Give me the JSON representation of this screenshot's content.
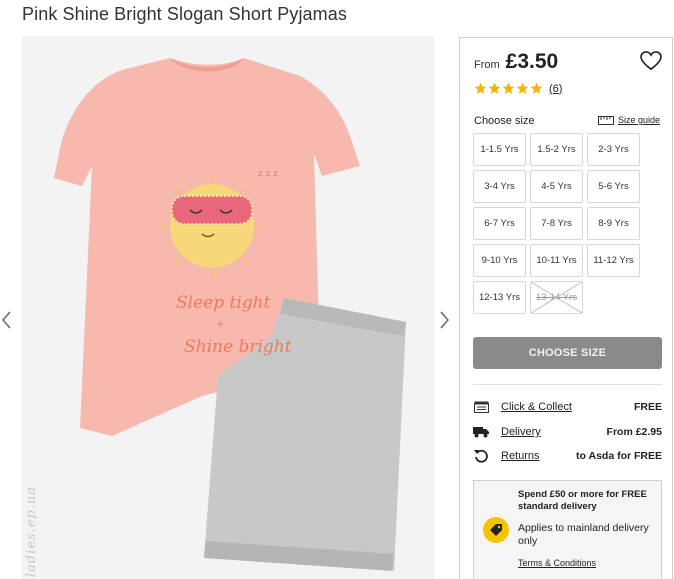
{
  "product": {
    "title": "Pink Shine Bright Slogan Short Pyjamas",
    "print_line1": "Sleep tight",
    "print_line2": "+",
    "print_line3": "Shine bright",
    "sleep_zzz": "z z z"
  },
  "gallery": {
    "watermark": "ladies.ep.ua"
  },
  "price": {
    "from_label": "From",
    "amount": "£3.50"
  },
  "rating": {
    "stars": 5,
    "count": "(6)",
    "star_color": "#f4b400"
  },
  "size": {
    "choose_label": "Choose size",
    "guide_label": "Size guide",
    "options": [
      {
        "label": "1-1.5 Yrs",
        "available": true
      },
      {
        "label": "1.5-2 Yrs",
        "available": true
      },
      {
        "label": "2-3 Yrs",
        "available": true
      },
      {
        "label": "3-4 Yrs",
        "available": true
      },
      {
        "label": "4-5 Yrs",
        "available": true
      },
      {
        "label": "5-6 Yrs",
        "available": true
      },
      {
        "label": "6-7 Yrs",
        "available": true
      },
      {
        "label": "7-8 Yrs",
        "available": true
      },
      {
        "label": "8-9 Yrs",
        "available": true
      },
      {
        "label": "9-10 Yrs",
        "available": true
      },
      {
        "label": "10-11 Yrs",
        "available": true
      },
      {
        "label": "11-12 Yrs",
        "available": true
      },
      {
        "label": "12-13 Yrs",
        "available": true
      },
      {
        "label": "13-14 Yrs",
        "available": false
      }
    ]
  },
  "cta": {
    "choose_size_button": "CHOOSE SIZE"
  },
  "delivery": {
    "click_collect": {
      "label": "Click & Collect",
      "value": "FREE",
      "icon": "store-icon"
    },
    "delivery": {
      "label": "Delivery",
      "value": "From £2.95",
      "icon": "truck-icon"
    },
    "returns": {
      "label": "Returns",
      "value": "to Asda for FREE",
      "icon": "return-icon"
    }
  },
  "promo": {
    "headline": "Spend £50 or more for FREE standard delivery",
    "text": "Applies to mainland delivery only",
    "link": "Terms & Conditions",
    "badge_icon": "tag-icon",
    "badge_color": "#f4c400"
  }
}
